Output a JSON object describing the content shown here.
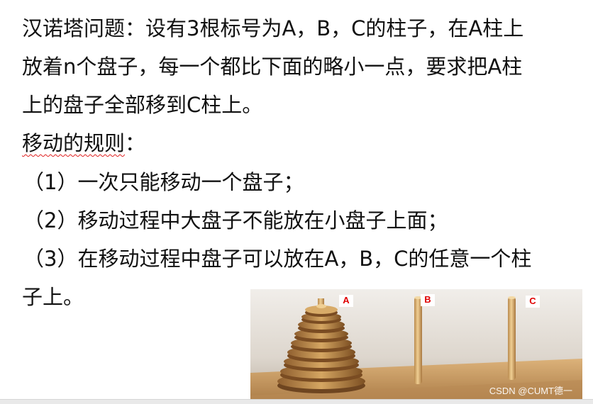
{
  "intro": {
    "line1": "汉诺塔问题：设有3根标号为A，B，C的柱子，在A柱上",
    "line2": "放着n个盘子，每一个都比下面的略小一点，要求把A柱",
    "line3": "上的盘子全部移到C柱上。"
  },
  "rules": {
    "heading": "移动的规则",
    "heading_colon": "：",
    "item1": "（1）一次只能移动一个盘子；",
    "item2": "（2）移动过程中大盘子不能放在小盘子上面；",
    "item3_line1": "（3）在移动过程中盘子可以放在A，B，C的任意一个柱",
    "item3_line2": "子上。"
  },
  "photo": {
    "labels": [
      "A",
      "B",
      "C"
    ],
    "watermark": "CSDN @CUMT德一",
    "colors": {
      "background_top": "#f0ede9",
      "background_bottom": "#c9c0b6",
      "wood_light": "#d9b06a",
      "wood_dark": "#8a5a2a",
      "label_text": "#e00000"
    }
  }
}
